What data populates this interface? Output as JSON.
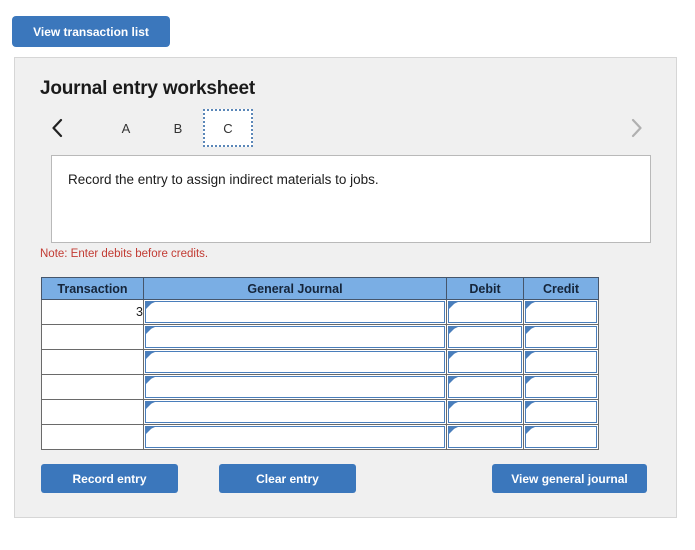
{
  "top_bar": {
    "view_transaction_list_label": "View transaction list"
  },
  "panel": {
    "title": "Journal entry worksheet"
  },
  "tabs": {
    "prev_icon": "chevron-left-icon",
    "next_icon": "chevron-right-icon",
    "items": [
      {
        "label": "A",
        "selected": false
      },
      {
        "label": "B",
        "selected": false
      },
      {
        "label": "C",
        "selected": true
      }
    ]
  },
  "description": {
    "text": "Record the entry to assign indirect materials to jobs."
  },
  "note": {
    "text": "Note: Enter debits before credits."
  },
  "journal_table": {
    "headers": {
      "transaction": "Transaction",
      "general_journal": "General Journal",
      "debit": "Debit",
      "credit": "Credit"
    },
    "rows": [
      {
        "transaction": "3",
        "general_journal": "",
        "debit": "",
        "credit": ""
      },
      {
        "transaction": "",
        "general_journal": "",
        "debit": "",
        "credit": ""
      },
      {
        "transaction": "",
        "general_journal": "",
        "debit": "",
        "credit": ""
      },
      {
        "transaction": "",
        "general_journal": "",
        "debit": "",
        "credit": ""
      },
      {
        "transaction": "",
        "general_journal": "",
        "debit": "",
        "credit": ""
      },
      {
        "transaction": "",
        "general_journal": "",
        "debit": "",
        "credit": ""
      }
    ]
  },
  "actions": {
    "record_entry_label": "Record entry",
    "clear_entry_label": "Clear entry",
    "view_general_journal_label": "View general journal"
  },
  "colors": {
    "button_blue": "#3b77bc",
    "table_header_blue": "#7aaee4",
    "note_red": "#c23b33",
    "panel_bg": "#f0f0f0",
    "input_border_blue": "#4a7ebb"
  }
}
